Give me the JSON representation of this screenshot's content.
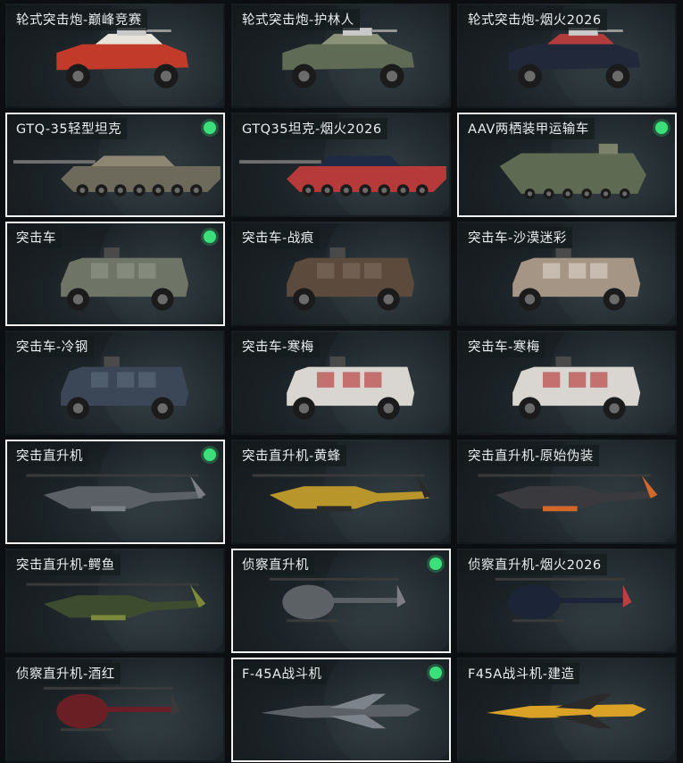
{
  "items": [
    {
      "label": "轮式突击炮-巅峰竞赛",
      "type": "wheeled",
      "body": "#c23a2a",
      "accent": "#e8e4dc",
      "selected": false,
      "owned": false
    },
    {
      "label": "轮式突击炮-护林人",
      "type": "wheeled",
      "body": "#5f6b55",
      "accent": "#8a9278",
      "selected": false,
      "owned": false
    },
    {
      "label": "轮式突击炮-烟火2026",
      "type": "wheeled",
      "body": "#20283a",
      "accent": "#b23b3b",
      "selected": false,
      "owned": false
    },
    {
      "label": "GTQ-35轻型坦克",
      "type": "tank",
      "body": "#8c8673",
      "accent": "#6d6a5c",
      "selected": true,
      "owned": true
    },
    {
      "label": "GTQ35坦克-烟火2026",
      "type": "tank",
      "body": "#1f2a44",
      "accent": "#b73a3a",
      "selected": false,
      "owned": false
    },
    {
      "label": "AAV两栖装甲运输车",
      "type": "aav",
      "body": "#5f6a52",
      "accent": "#7b836b",
      "selected": true,
      "owned": true
    },
    {
      "label": "突击车",
      "type": "mrap",
      "body": "#6e7566",
      "accent": "#8f9486",
      "selected": true,
      "owned": true
    },
    {
      "label": "突击车-战痕",
      "type": "mrap",
      "body": "#5c4a3d",
      "accent": "#7a6a5a",
      "selected": false,
      "owned": false
    },
    {
      "label": "突击车-沙漠迷彩",
      "type": "mrap",
      "body": "#a59584",
      "accent": "#d6cdc2",
      "selected": false,
      "owned": false
    },
    {
      "label": "突击车-冷钢",
      "type": "mrap",
      "body": "#3b4656",
      "accent": "#5a6676",
      "selected": false,
      "owned": false
    },
    {
      "label": "突击车-寒梅",
      "type": "mrap",
      "body": "#d9d6d2",
      "accent": "#b94545",
      "selected": false,
      "owned": false
    },
    {
      "label": "突击车-寒梅",
      "type": "mrap",
      "body": "#d9d6d2",
      "accent": "#b94545",
      "selected": false,
      "owned": false
    },
    {
      "label": "突击直升机",
      "type": "apache",
      "body": "#5a6066",
      "accent": "#7a8086",
      "selected": true,
      "owned": true
    },
    {
      "label": "突击直升机-黄蜂",
      "type": "apache",
      "body": "#b9962c",
      "accent": "#2a2a2a",
      "selected": false,
      "owned": false
    },
    {
      "label": "突击直升机-原始伪装",
      "type": "apache",
      "body": "#3a3a3e",
      "accent": "#d4682a",
      "selected": false,
      "owned": false
    },
    {
      "label": "突击直升机-鳄鱼",
      "type": "apache",
      "body": "#3d4c2e",
      "accent": "#7a8a3a",
      "selected": false,
      "owned": false
    },
    {
      "label": "侦察直升机",
      "type": "scout",
      "body": "#5c6166",
      "accent": "#7b8084",
      "selected": true,
      "owned": true
    },
    {
      "label": "侦察直升机-烟火2026",
      "type": "scout",
      "body": "#1c2438",
      "accent": "#b84040",
      "selected": false,
      "owned": false
    },
    {
      "label": "侦察直升机-酒红",
      "type": "scout",
      "body": "#6a1f24",
      "accent": "#3a3a3a",
      "selected": false,
      "owned": false
    },
    {
      "label": "F-45A战斗机",
      "type": "jet",
      "body": "#5b6067",
      "accent": "#7d838a",
      "selected": true,
      "owned": true
    },
    {
      "label": "F45A战斗机-建造",
      "type": "jet",
      "body": "#d9a227",
      "accent": "#2a2a2a",
      "selected": false,
      "owned": false
    }
  ]
}
